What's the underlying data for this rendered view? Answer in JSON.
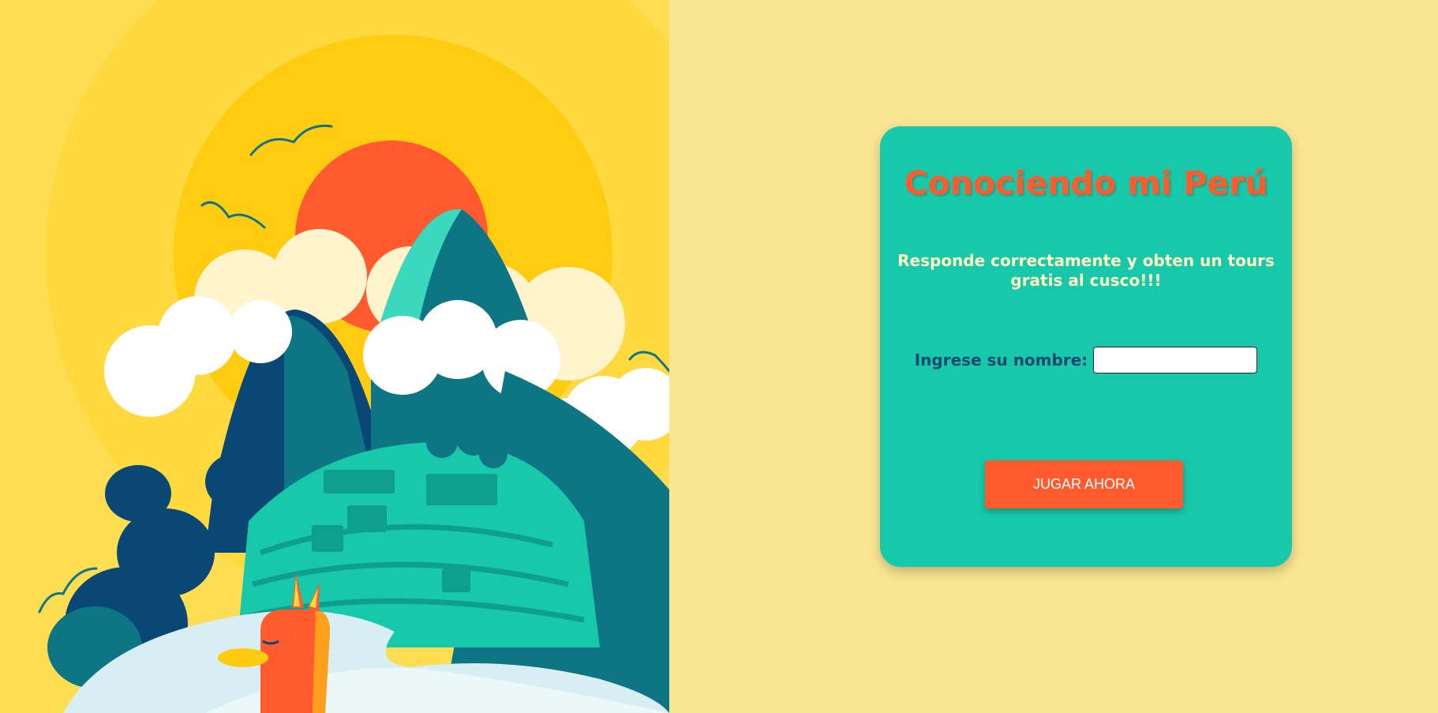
{
  "illustration": {
    "icon": "machu-picchu-llama-illustration"
  },
  "form": {
    "title": "Conociendo mi Perú",
    "subtitle": "Responde correctamente y obten un tours gratis al cusco!!!",
    "name_label": "Ingrese su nombre:",
    "name_value": "",
    "name_placeholder": "",
    "play_button_label": "JUGAR AHORA"
  },
  "colors": {
    "page_background": "#fae592",
    "card_background": "#17c9aa",
    "title": "#ff5b2e",
    "subtitle": "#fff7c2",
    "label": "#0f4a6e",
    "button": "#ff5b2e"
  }
}
